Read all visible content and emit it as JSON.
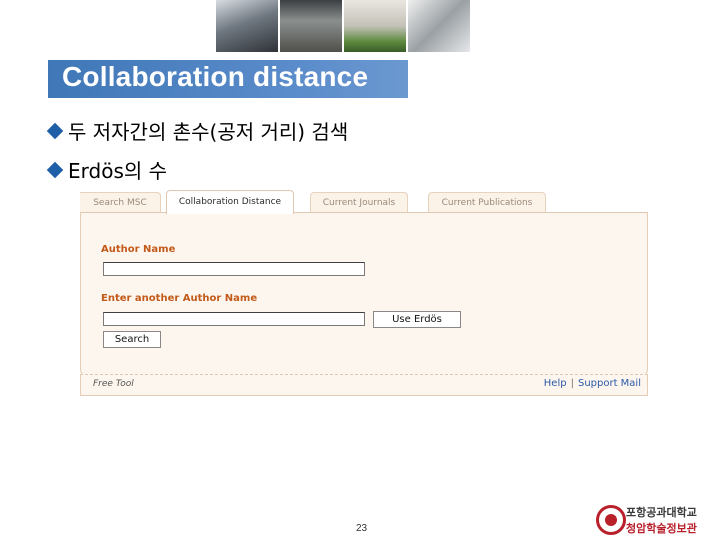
{
  "slide": {
    "title": "Collaboration distance",
    "bullets": [
      "두 저자간의 촌수(공저 거리) 검색",
      "Erdös의 수"
    ],
    "page_number": "23"
  },
  "widget": {
    "tabs": [
      {
        "label": "Search MSC",
        "active": false
      },
      {
        "label": "Collaboration Distance",
        "active": true
      },
      {
        "label": "Current Journals",
        "active": false
      },
      {
        "label": "Current Publications",
        "active": false
      }
    ],
    "author_name_label": "Author Name",
    "author_name_value": "",
    "another_author_label": "Enter another Author Name",
    "another_author_value": "",
    "use_erdos_button": "Use Erdös",
    "search_button": "Search",
    "footer": {
      "free_tool": "Free Tool",
      "help_link": "Help",
      "separator": "|",
      "support_link": "Support Mail"
    }
  },
  "branding": {
    "institution_line1": "포항공과대학교",
    "institution_line2": "청암학술정보관"
  },
  "colors": {
    "title_bar": "#4a80c0",
    "label_orange": "#c25a1a",
    "link_blue": "#2a5aa8",
    "panel_bg": "#fdf6ee",
    "logo_red": "#b8202a"
  }
}
